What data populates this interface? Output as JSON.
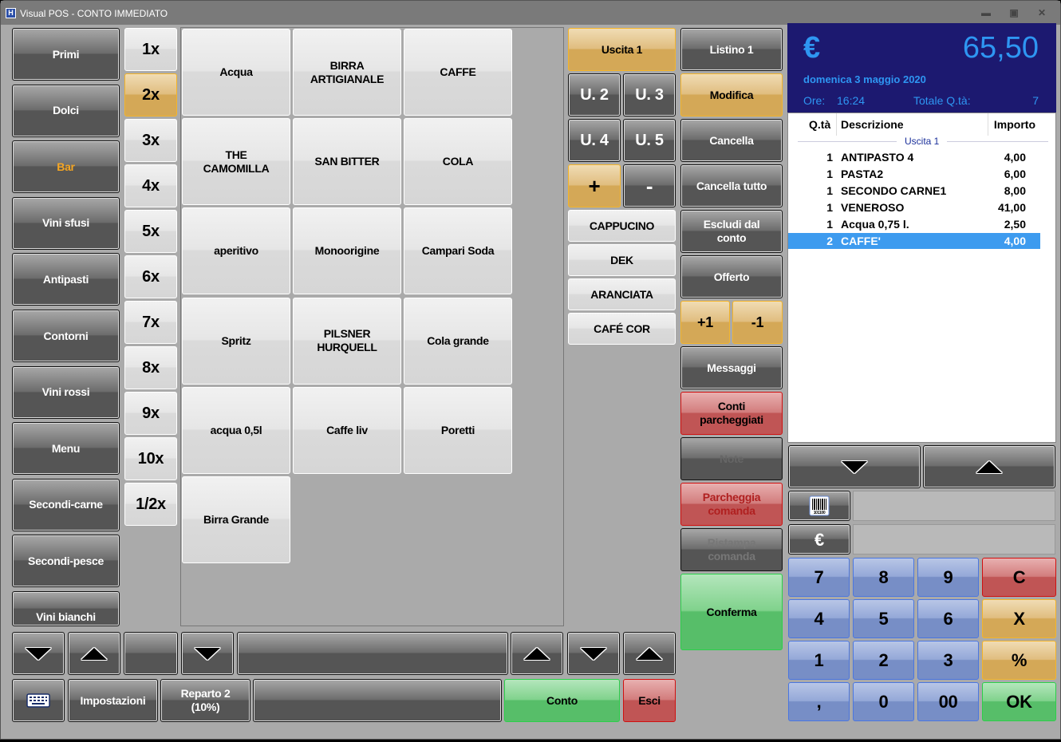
{
  "window": {
    "title": "Visual POS - CONTO IMMEDIATO",
    "app_icon": "visualpos-logo-icon",
    "controls": [
      "minimize-icon",
      "maximize-icon",
      "close-icon"
    ]
  },
  "categories": [
    {
      "label": "Primi",
      "active": false
    },
    {
      "label": "Dolci",
      "active": false
    },
    {
      "label": "Bar",
      "active": true
    },
    {
      "label": "Vini sfusi",
      "active": false
    },
    {
      "label": "Antipasti",
      "active": false
    },
    {
      "label": "Contorni",
      "active": false
    },
    {
      "label": "Vini rossi",
      "active": false
    },
    {
      "label": "Menu",
      "active": false
    },
    {
      "label": "Secondi-carne",
      "active": false
    },
    {
      "label": "Secondi-pesce",
      "active": false
    },
    {
      "label": "Vini bianchi",
      "active": false
    }
  ],
  "active_category_color": "#f5a623",
  "multipliers": [
    {
      "label": "1x",
      "active": false
    },
    {
      "label": "2x",
      "active": true
    },
    {
      "label": "3x",
      "active": false
    },
    {
      "label": "4x",
      "active": false
    },
    {
      "label": "5x",
      "active": false
    },
    {
      "label": "6x",
      "active": false
    },
    {
      "label": "7x",
      "active": false
    },
    {
      "label": "8x",
      "active": false
    },
    {
      "label": "9x",
      "active": false
    },
    {
      "label": "10x",
      "active": false
    },
    {
      "label": "1/2x",
      "active": false
    }
  ],
  "products": [
    "Acqua",
    "BIRRA\nARTIGIANALE",
    "CAFFE",
    "THE\nCAMOMILLA",
    "SAN BITTER",
    "COLA",
    "aperitivo",
    "Monoorigine",
    "Campari Soda",
    "Spritz",
    "PILSNER\nHURQUELL",
    "Cola grande",
    "acqua 0,5l",
    "Caffe liv",
    "Poretti",
    "Birra Grande"
  ],
  "exits": {
    "current": "Uscita 1",
    "others": [
      "U. 2",
      "U. 3",
      "U. 4",
      "U. 5"
    ],
    "plus": "+",
    "minus": "-"
  },
  "quick_items": [
    "CAPPUCINO",
    "DEK",
    "ARANCIATA",
    "CAFÉ COR"
  ],
  "actions": {
    "listino": "Listino 1",
    "modifica": "Modifica",
    "cancella": "Cancella",
    "cancella_tutto": "Cancella tutto",
    "escludi": "Escludi dal conto",
    "offerto": "Offerto",
    "plus_one": "+1",
    "minus_one": "-1",
    "messaggi": "Messaggi",
    "conti_parcheggiati": "Conti parcheggiati",
    "note": "Note",
    "parcheggia": "Parcheggia comanda",
    "ristampa": "Ristampa comanda",
    "conferma": "Conferma"
  },
  "bottom_bar": {
    "keyboard_icon": "keyboard-icon",
    "impostazioni": "Impostazioni",
    "reparto": "Reparto 2\n(10%)",
    "conto": "Conto",
    "esci": "Esci"
  },
  "display": {
    "currency": "€",
    "total": "65,50",
    "date": "domenica 3 maggio 2020",
    "time_label": "Ore:",
    "time": "16:24",
    "qty_label": "Totale Q.tà:",
    "qty": "7"
  },
  "receipt": {
    "headers": {
      "qty": "Q.tà",
      "desc": "Descrizione",
      "amount": "Importo"
    },
    "group_label": "Uscita 1",
    "rows": [
      {
        "qty": "1",
        "desc": "ANTIPASTO 4",
        "amount": "4,00",
        "selected": false
      },
      {
        "qty": "1",
        "desc": "PASTA2",
        "amount": "6,00",
        "selected": false
      },
      {
        "qty": "1",
        "desc": "SECONDO CARNE1",
        "amount": "8,00",
        "selected": false
      },
      {
        "qty": "1",
        "desc": "VENEROSO",
        "amount": "41,00",
        "selected": false
      },
      {
        "qty": "1",
        "desc": "Acqua 0,75 l.",
        "amount": "2,50",
        "selected": false
      },
      {
        "qty": "2",
        "desc": "CAFFE'",
        "amount": "4,00",
        "selected": true
      }
    ]
  },
  "input_fields": {
    "barcode_icon": "barcode-icon",
    "barcode_value": "",
    "euro_label": "€",
    "euro_value": ""
  },
  "keypad": [
    [
      "7",
      "8",
      "9",
      "C"
    ],
    [
      "4",
      "5",
      "6",
      "X"
    ],
    [
      "1",
      "2",
      "3",
      "%"
    ],
    [
      ",",
      "0",
      "00",
      "OK"
    ]
  ],
  "colors": {
    "display_bg": "#1c1970",
    "display_fg": "#2e96f2",
    "selection": "#3d9bef"
  }
}
